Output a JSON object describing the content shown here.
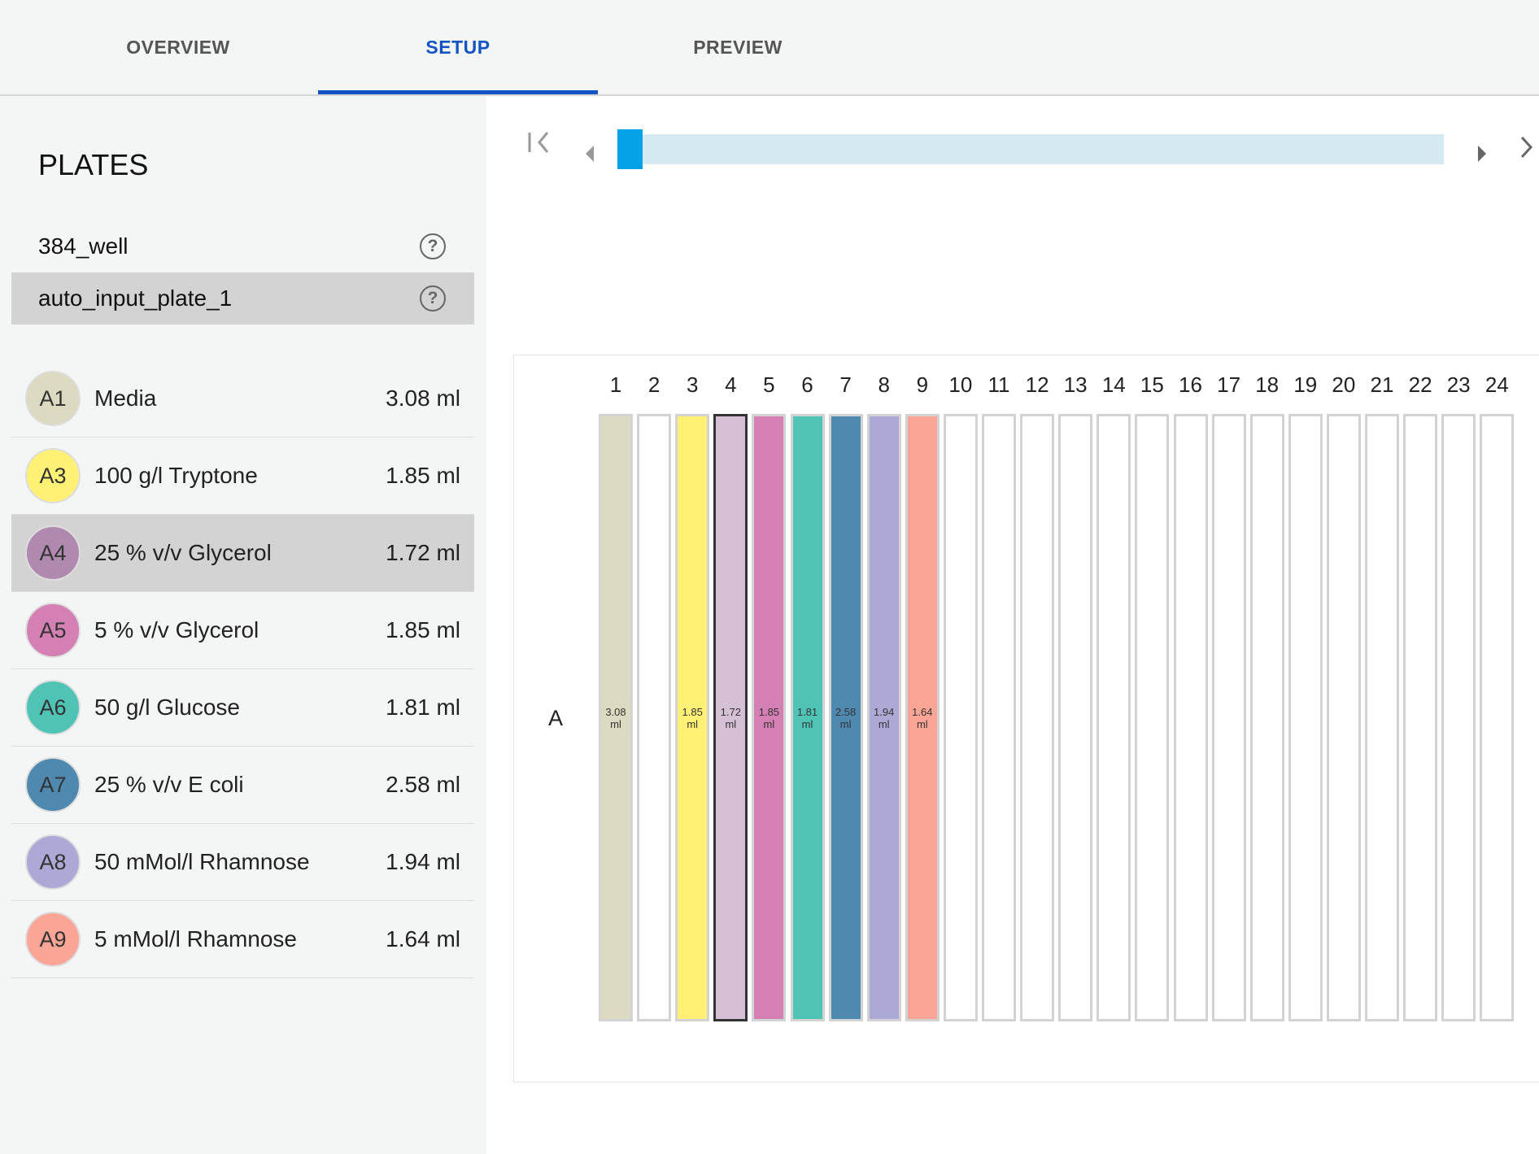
{
  "tabs": [
    {
      "label": "OVERVIEW"
    },
    {
      "label": "SETUP",
      "active": true
    },
    {
      "label": "PREVIEW"
    }
  ],
  "sidebar": {
    "title": "PLATES",
    "plates": [
      {
        "name": "384_well",
        "selected": false
      },
      {
        "name": "auto_input_plate_1",
        "selected": true
      }
    ],
    "help_icon": "?",
    "reagents": [
      {
        "well": "A1",
        "name": "Media",
        "volume": "3.08 ml",
        "color": "#dcdac0"
      },
      {
        "well": "A3",
        "name": "100 g/l Tryptone",
        "volume": "1.85 ml",
        "color": "#fff176"
      },
      {
        "well": "A4",
        "name": "25 % v/v Glycerol",
        "volume": "1.72 ml",
        "color": "#b089b0",
        "selected": true
      },
      {
        "well": "A5",
        "name": "5 % v/v Glycerol",
        "volume": "1.85 ml",
        "color": "#d580b4"
      },
      {
        "well": "A6",
        "name": "50 g/l Glucose",
        "volume": "1.81 ml",
        "color": "#4fc4b6"
      },
      {
        "well": "A7",
        "name": "25 % v/v E coli",
        "volume": "2.58 ml",
        "color": "#4f89b0"
      },
      {
        "well": "A8",
        "name": "50 mMol/l Rhamnose",
        "volume": "1.94 ml",
        "color": "#ada9d6"
      },
      {
        "well": "A9",
        "name": "5 mMol/l Rhamnose",
        "volume": "1.64 ml",
        "color": "#fba596"
      }
    ]
  },
  "slider": {
    "position": 0,
    "icons": [
      "first-page-icon",
      "prev-icon",
      "next-icon",
      "last-icon"
    ]
  },
  "plate": {
    "row_label": "A",
    "columns": [
      "1",
      "2",
      "3",
      "4",
      "5",
      "6",
      "7",
      "8",
      "9",
      "10",
      "11",
      "12",
      "13",
      "14",
      "15",
      "16",
      "17",
      "18",
      "19",
      "20",
      "21",
      "22",
      "23",
      "24"
    ],
    "wells": [
      {
        "col": 1,
        "value": "3.08",
        "unit": "ml",
        "color": "#dcdac0"
      },
      {
        "col": 3,
        "value": "1.85",
        "unit": "ml",
        "color": "#fff176"
      },
      {
        "col": 4,
        "value": "1.72",
        "unit": "ml",
        "color": "#d6c0d6",
        "selected": true
      },
      {
        "col": 5,
        "value": "1.85",
        "unit": "ml",
        "color": "#d580b4"
      },
      {
        "col": 6,
        "value": "1.81",
        "unit": "ml",
        "color": "#4fc4b6"
      },
      {
        "col": 7,
        "value": "2.58",
        "unit": "ml",
        "color": "#4f89b0"
      },
      {
        "col": 8,
        "value": "1.94",
        "unit": "ml",
        "color": "#ada9d6"
      },
      {
        "col": 9,
        "value": "1.64",
        "unit": "ml",
        "color": "#fba596"
      }
    ]
  }
}
